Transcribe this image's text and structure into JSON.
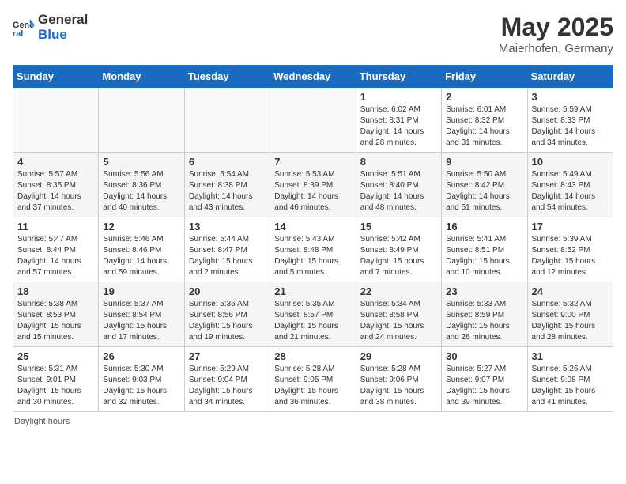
{
  "header": {
    "logo_general": "General",
    "logo_blue": "Blue",
    "month_title": "May 2025",
    "location": "Maierhofen, Germany"
  },
  "footer": {
    "note": "Daylight hours"
  },
  "days_of_week": [
    "Sunday",
    "Monday",
    "Tuesday",
    "Wednesday",
    "Thursday",
    "Friday",
    "Saturday"
  ],
  "weeks": [
    [
      {
        "num": "",
        "info": ""
      },
      {
        "num": "",
        "info": ""
      },
      {
        "num": "",
        "info": ""
      },
      {
        "num": "",
        "info": ""
      },
      {
        "num": "1",
        "info": "Sunrise: 6:02 AM\nSunset: 8:31 PM\nDaylight: 14 hours\nand 28 minutes."
      },
      {
        "num": "2",
        "info": "Sunrise: 6:01 AM\nSunset: 8:32 PM\nDaylight: 14 hours\nand 31 minutes."
      },
      {
        "num": "3",
        "info": "Sunrise: 5:59 AM\nSunset: 8:33 PM\nDaylight: 14 hours\nand 34 minutes."
      }
    ],
    [
      {
        "num": "4",
        "info": "Sunrise: 5:57 AM\nSunset: 8:35 PM\nDaylight: 14 hours\nand 37 minutes."
      },
      {
        "num": "5",
        "info": "Sunrise: 5:56 AM\nSunset: 8:36 PM\nDaylight: 14 hours\nand 40 minutes."
      },
      {
        "num": "6",
        "info": "Sunrise: 5:54 AM\nSunset: 8:38 PM\nDaylight: 14 hours\nand 43 minutes."
      },
      {
        "num": "7",
        "info": "Sunrise: 5:53 AM\nSunset: 8:39 PM\nDaylight: 14 hours\nand 46 minutes."
      },
      {
        "num": "8",
        "info": "Sunrise: 5:51 AM\nSunset: 8:40 PM\nDaylight: 14 hours\nand 48 minutes."
      },
      {
        "num": "9",
        "info": "Sunrise: 5:50 AM\nSunset: 8:42 PM\nDaylight: 14 hours\nand 51 minutes."
      },
      {
        "num": "10",
        "info": "Sunrise: 5:49 AM\nSunset: 8:43 PM\nDaylight: 14 hours\nand 54 minutes."
      }
    ],
    [
      {
        "num": "11",
        "info": "Sunrise: 5:47 AM\nSunset: 8:44 PM\nDaylight: 14 hours\nand 57 minutes."
      },
      {
        "num": "12",
        "info": "Sunrise: 5:46 AM\nSunset: 8:46 PM\nDaylight: 14 hours\nand 59 minutes."
      },
      {
        "num": "13",
        "info": "Sunrise: 5:44 AM\nSunset: 8:47 PM\nDaylight: 15 hours\nand 2 minutes."
      },
      {
        "num": "14",
        "info": "Sunrise: 5:43 AM\nSunset: 8:48 PM\nDaylight: 15 hours\nand 5 minutes."
      },
      {
        "num": "15",
        "info": "Sunrise: 5:42 AM\nSunset: 8:49 PM\nDaylight: 15 hours\nand 7 minutes."
      },
      {
        "num": "16",
        "info": "Sunrise: 5:41 AM\nSunset: 8:51 PM\nDaylight: 15 hours\nand 10 minutes."
      },
      {
        "num": "17",
        "info": "Sunrise: 5:39 AM\nSunset: 8:52 PM\nDaylight: 15 hours\nand 12 minutes."
      }
    ],
    [
      {
        "num": "18",
        "info": "Sunrise: 5:38 AM\nSunset: 8:53 PM\nDaylight: 15 hours\nand 15 minutes."
      },
      {
        "num": "19",
        "info": "Sunrise: 5:37 AM\nSunset: 8:54 PM\nDaylight: 15 hours\nand 17 minutes."
      },
      {
        "num": "20",
        "info": "Sunrise: 5:36 AM\nSunset: 8:56 PM\nDaylight: 15 hours\nand 19 minutes."
      },
      {
        "num": "21",
        "info": "Sunrise: 5:35 AM\nSunset: 8:57 PM\nDaylight: 15 hours\nand 21 minutes."
      },
      {
        "num": "22",
        "info": "Sunrise: 5:34 AM\nSunset: 8:58 PM\nDaylight: 15 hours\nand 24 minutes."
      },
      {
        "num": "23",
        "info": "Sunrise: 5:33 AM\nSunset: 8:59 PM\nDaylight: 15 hours\nand 26 minutes."
      },
      {
        "num": "24",
        "info": "Sunrise: 5:32 AM\nSunset: 9:00 PM\nDaylight: 15 hours\nand 28 minutes."
      }
    ],
    [
      {
        "num": "25",
        "info": "Sunrise: 5:31 AM\nSunset: 9:01 PM\nDaylight: 15 hours\nand 30 minutes."
      },
      {
        "num": "26",
        "info": "Sunrise: 5:30 AM\nSunset: 9:03 PM\nDaylight: 15 hours\nand 32 minutes."
      },
      {
        "num": "27",
        "info": "Sunrise: 5:29 AM\nSunset: 9:04 PM\nDaylight: 15 hours\nand 34 minutes."
      },
      {
        "num": "28",
        "info": "Sunrise: 5:28 AM\nSunset: 9:05 PM\nDaylight: 15 hours\nand 36 minutes."
      },
      {
        "num": "29",
        "info": "Sunrise: 5:28 AM\nSunset: 9:06 PM\nDaylight: 15 hours\nand 38 minutes."
      },
      {
        "num": "30",
        "info": "Sunrise: 5:27 AM\nSunset: 9:07 PM\nDaylight: 15 hours\nand 39 minutes."
      },
      {
        "num": "31",
        "info": "Sunrise: 5:26 AM\nSunset: 9:08 PM\nDaylight: 15 hours\nand 41 minutes."
      }
    ]
  ]
}
